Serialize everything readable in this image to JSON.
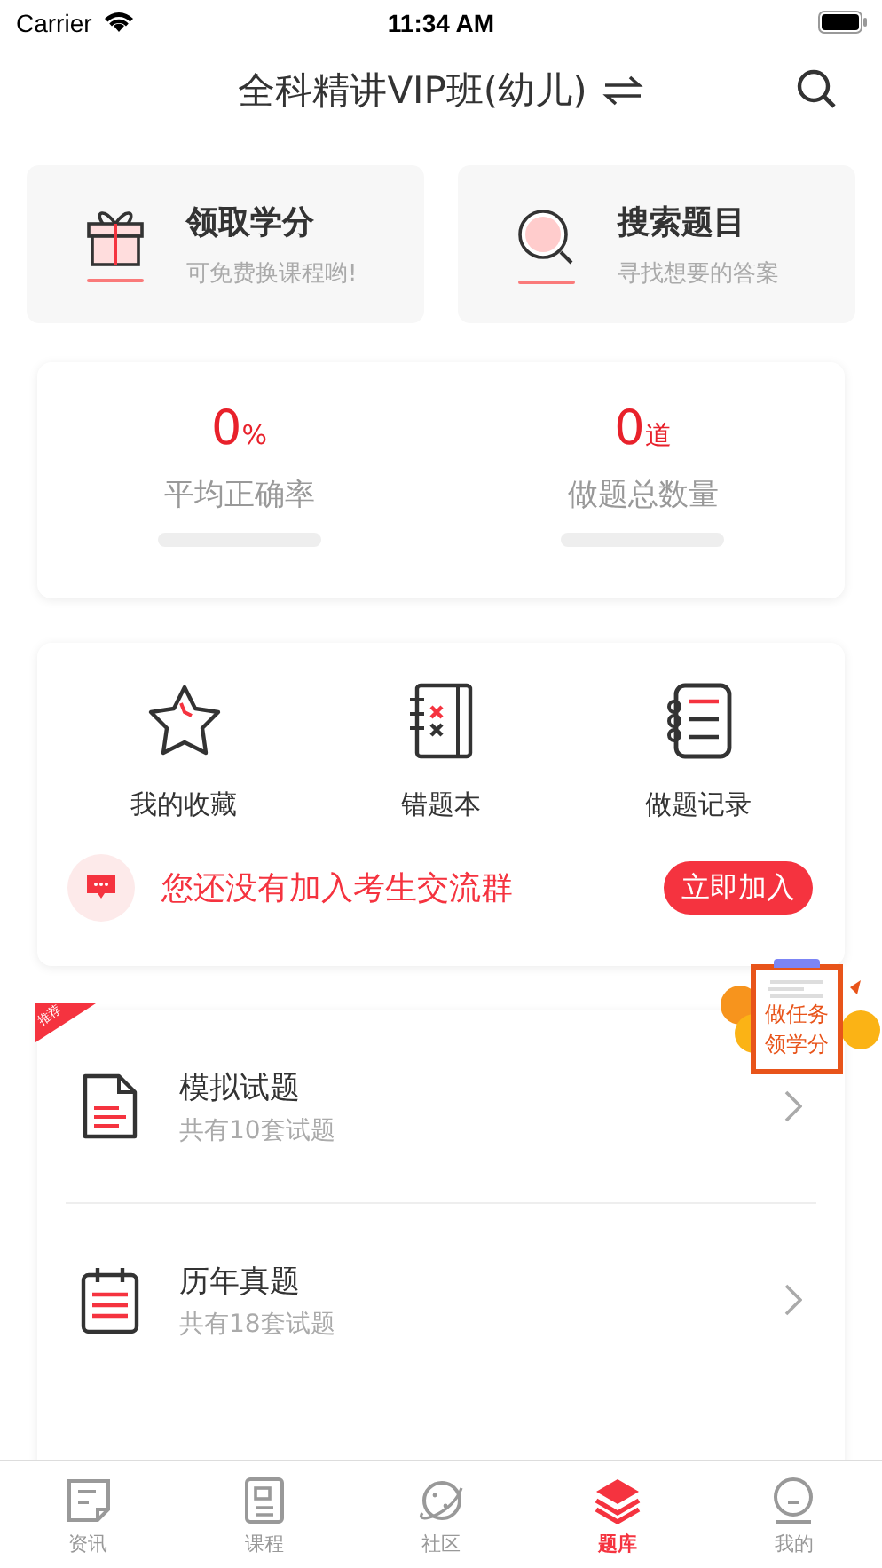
{
  "status_bar": {
    "carrier": "Carrier",
    "time": "11:34 AM"
  },
  "nav": {
    "title": "全科精讲VIP班(幼儿)"
  },
  "quick_cards": [
    {
      "kind": "gift",
      "title": "领取学分",
      "subtitle": "可免费换课程哟!"
    },
    {
      "kind": "search",
      "title": "搜索题目",
      "subtitle": "寻找想要的答案"
    }
  ],
  "stats": [
    {
      "value": "0",
      "unit": "%",
      "label": "平均正确率"
    },
    {
      "value": "0",
      "unit": "道",
      "label": "做题总数量"
    }
  ],
  "features": [
    {
      "kind": "star",
      "label": "我的收藏"
    },
    {
      "kind": "wrongbook",
      "label": "错题本"
    },
    {
      "kind": "record",
      "label": "做题记录"
    }
  ],
  "group_banner": {
    "text": "您还没有加入考生交流群",
    "button": "立即加入"
  },
  "task_badge": {
    "line_1": "做任务",
    "line_2": "领学分"
  },
  "list": {
    "ribbon": "推荐",
    "items": [
      {
        "kind": "doc",
        "title": "模拟试题",
        "subtitle": "共有10套试题"
      },
      {
        "kind": "calendar",
        "title": "历年真题",
        "subtitle": "共有18套试题"
      }
    ]
  },
  "tab_bar": [
    {
      "kind": "news",
      "label": "资讯",
      "selected": false
    },
    {
      "kind": "course",
      "label": "课程",
      "selected": false
    },
    {
      "kind": "planet",
      "label": "社区",
      "selected": false
    },
    {
      "kind": "layers",
      "label": "题库",
      "selected": true
    },
    {
      "kind": "face",
      "label": "我的",
      "selected": false
    }
  ]
}
